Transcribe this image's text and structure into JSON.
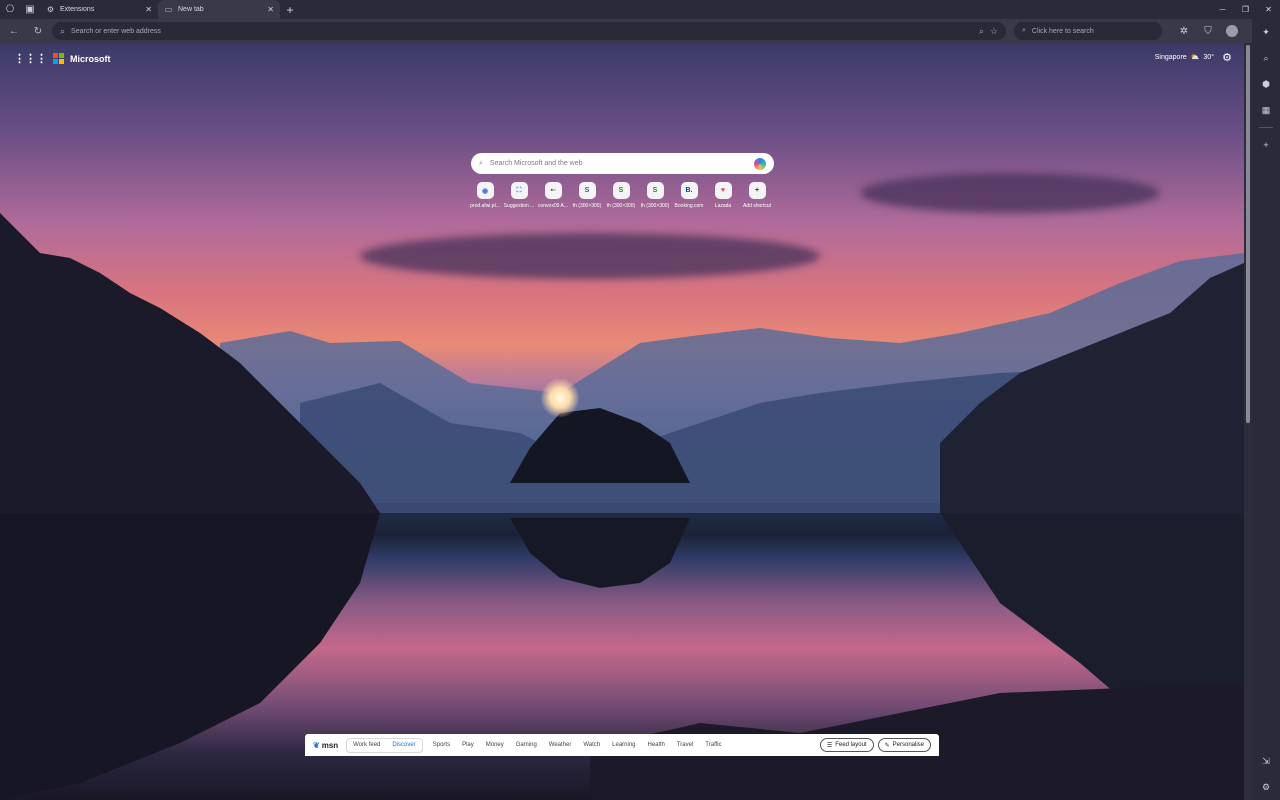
{
  "tabs": [
    {
      "label": "Extensions",
      "icon": "puzzle-icon",
      "active": false
    },
    {
      "label": "New tab",
      "icon": "newtab-icon",
      "active": true
    }
  ],
  "address_bar": {
    "placeholder": "Search or enter web address"
  },
  "top_search": {
    "placeholder": "Click here to search"
  },
  "page": {
    "brand": "Microsoft",
    "weather": {
      "city": "Singapore",
      "temp": "30°"
    },
    "search_placeholder": "Search Microsoft and the web"
  },
  "shortcuts": [
    {
      "label": "prod.afwi.pl...",
      "glyph": "◉",
      "color": "#3a7bd5"
    },
    {
      "label": "Suggestion ...",
      "glyph": "⛶",
      "color": "#2b8ad6"
    },
    {
      "label": "convox09 A...",
      "glyph": "▪▫",
      "color": "#444"
    },
    {
      "label": "th (300×300)",
      "glyph": "S",
      "color": "#2c5f8a"
    },
    {
      "label": "th (300×300)",
      "glyph": "S",
      "color": "#2e7d32"
    },
    {
      "label": "th (300×300)",
      "glyph": "S",
      "color": "#2e7d32"
    },
    {
      "label": "Booking.com",
      "glyph": "B.",
      "color": "#0b3d91"
    },
    {
      "label": "Lazada",
      "glyph": "♥",
      "color": "#e23b5a"
    },
    {
      "label": "Add shortcut",
      "glyph": "+",
      "color": "#333"
    }
  ],
  "msn": {
    "logo": "msn",
    "feed_tabs": [
      {
        "label": "Work feed",
        "selected": false
      },
      {
        "label": "Discover",
        "selected": true
      }
    ],
    "categories": [
      "Sports",
      "Play",
      "Money",
      "Gaming",
      "Weather",
      "Watch",
      "Learning",
      "Health",
      "Travel",
      "Traffic"
    ],
    "feed_layout": "Feed layout",
    "personalise": "Personalise"
  }
}
